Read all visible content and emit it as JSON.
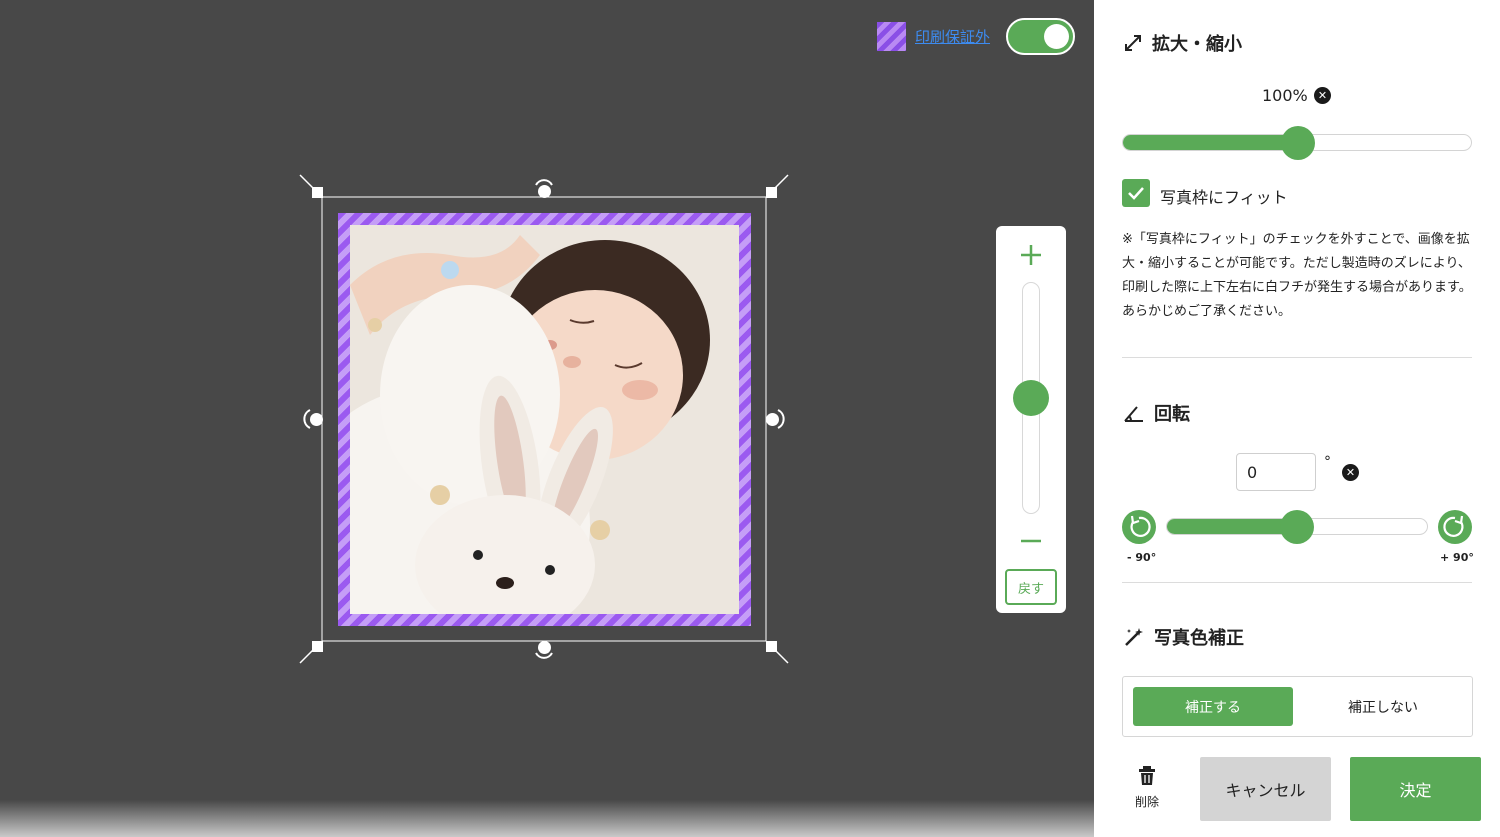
{
  "colors": {
    "accent": "#5aaa57",
    "canvas": "#484848",
    "print_guarantee_stripe": "#9b5af0",
    "link": "#3d8bf0"
  },
  "canvas": {
    "print_guarantee_label": "印刷保証外",
    "print_guarantee_toggle_on": true,
    "reset_label": "戻す",
    "zoom_plus_icon": "plus-icon",
    "zoom_minus_icon": "minus-icon"
  },
  "scale": {
    "title": "拡大・縮小",
    "value_text": "100%",
    "slider_level": 0.5,
    "fit_checked": true,
    "fit_label": "写真枠にフィット",
    "note": "※「写真枠にフィット」のチェックを外すことで、画像を拡大・縮小することが可能です。ただし製造時のズレにより、印刷した際に上下左右に白フチが発生する場合があります。あらかじめご了承ください。"
  },
  "rotation": {
    "title": "回転",
    "value": "0",
    "unit": "°",
    "slider_level": 0.5,
    "minus_label": "- 90°",
    "plus_label": "+ 90°"
  },
  "color_correction": {
    "title": "写真色補正",
    "on_label": "補正する",
    "off_label": "補正しない"
  },
  "footer": {
    "delete_label": "削除",
    "cancel_label": "キャンセル",
    "ok_label": "決定"
  }
}
